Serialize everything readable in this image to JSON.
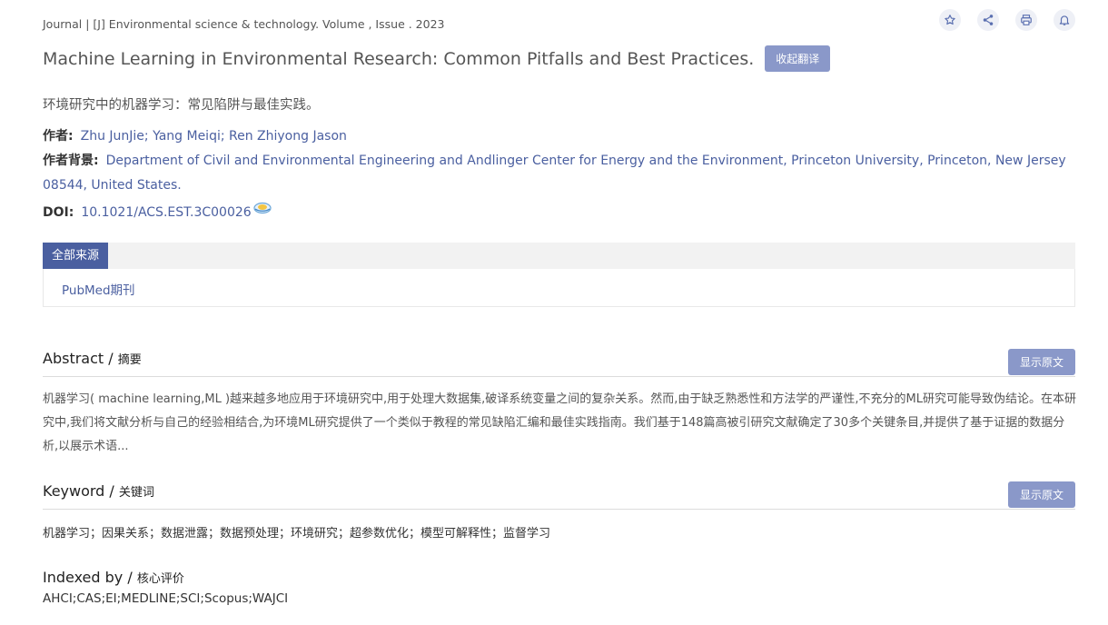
{
  "journal_line": "Journal | [J] Environmental science & technology. Volume , Issue . 2023",
  "toolbar_icons": [
    "star-icon",
    "share-icon",
    "print-icon",
    "bell-icon"
  ],
  "article": {
    "title": "Machine Learning in Environmental Research: Common Pitfalls and Best Practices.",
    "collapse_translation_label": "收起翻译",
    "title_cn": "环境研究中的机器学习：常见陷阱与最佳实践。",
    "authors_label": "作者:",
    "authors": "Zhu JunJie; Yang Meiqi; Ren Zhiyong Jason",
    "affiliation_label": "作者背景:",
    "affiliation": "Department of Civil and Environmental Engineering and Andlinger Center for Energy and the Environment, Princeton University, Princeton, New Jersey 08544, United States.",
    "doi_label": "DOI:",
    "doi": "10.1021/ACS.EST.3C00026"
  },
  "sources": {
    "tab_label": "全部来源",
    "items": [
      "PubMed期刊"
    ]
  },
  "abstract": {
    "title": "Abstract / ",
    "title_cn": "摘要",
    "show_original_label": "显示原文",
    "text": "机器学习( machine learning,ML )越来越多地应用于环境研究中,用于处理大数据集,破译系统变量之间的复杂关系。然而,由于缺乏熟悉性和方法学的严谨性,不充分的ML研究可能导致伪结论。在本研究中,我们将文献分析与自己的经验相结合,为环境ML研究提供了一个类似于教程的常见缺陷汇编和最佳实践指南。我们基于148篇高被引研究文献确定了30多个关键条目,并提供了基于证据的数据分析,以展示术语..."
  },
  "keyword": {
    "title": "Keyword / ",
    "title_cn": "关键词",
    "show_original_label": "显示原文",
    "text": "机器学习；因果关系；数据泄露；数据预处理；环境研究；超参数优化；模型可解释性；监督学习"
  },
  "indexed": {
    "title": "Indexed by / ",
    "title_cn": "核心评价",
    "text": "AHCI;CAS;EI;MEDLINE;SCI;Scopus;WAJCI"
  }
}
